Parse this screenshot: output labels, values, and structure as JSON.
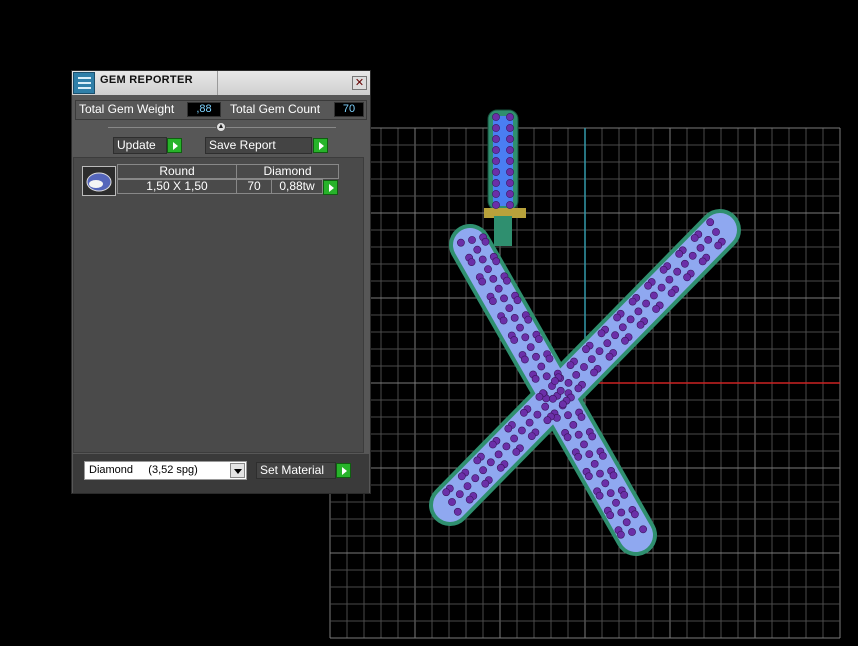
{
  "window": {
    "title": "GEM REPORTER",
    "close_glyph": "✕",
    "icon": "app-icon"
  },
  "summary": {
    "weight_label": "Total Gem Weight",
    "weight_value": ",88",
    "count_label": "Total Gem Count",
    "count_value": "70"
  },
  "actions": {
    "update_label": "Update",
    "save_report_label": "Save Report"
  },
  "gem_table": {
    "thumbnail_icon": "round-diamond-icon",
    "rows": [
      {
        "shape": "Round",
        "material": "Diamond",
        "size": "1,50 X 1,50",
        "count": "70",
        "weight": "0,88tw"
      }
    ]
  },
  "material": {
    "select_value": "Diamond     (3,52 spg)",
    "set_material_label": "Set Material"
  },
  "colors": {
    "accent_green": "#27b32a",
    "value_text": "#7fd4ff",
    "grid": "#5a5a5a",
    "gem_body": "#8fa8f0",
    "gem_outline": "#2f8f6f",
    "stone": "#6b2fa8",
    "x_axis": "#cc2222",
    "y_axis": "#3399aa"
  }
}
